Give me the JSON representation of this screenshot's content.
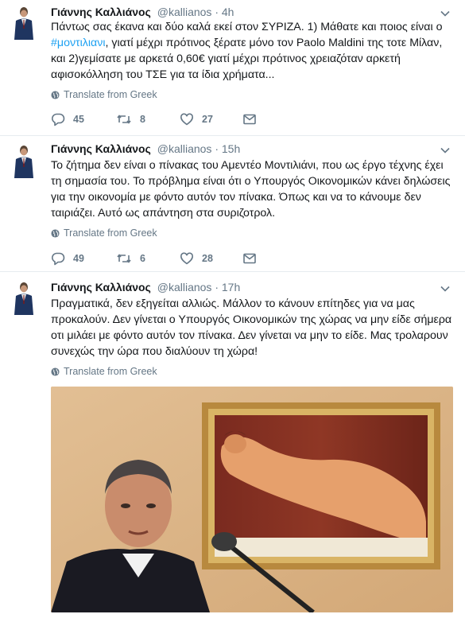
{
  "tweets": [
    {
      "name": "Γιάννης Καλλιάνος",
      "handle": "@kallianos",
      "sep": "·",
      "time": "4h",
      "text_before": "Πάντως σας έκανα και δύο καλά εκεί στον ΣΥΡΙΖΑ. 1) Μάθατε και ποιος είναι ο ",
      "hashtag": "#μοντιλιανι",
      "text_after": ", γιατί μέχρι πρότινος ξέρατε μόνο τον   Paolo Maldini της τοτε Μίλαν, και 2)γεμίσατε με αρκετά 0,60€ γιατί μέχρι πρότινος χρειαζόταν αρκετή αφισοκόλληση του ΤΣΕ για τα ίδια χρήματα...",
      "translate": "Translate from Greek",
      "replies": "45",
      "retweets": "8",
      "likes": "27"
    },
    {
      "name": "Γιάννης Καλλιάνος",
      "handle": "@kallianos",
      "sep": "·",
      "time": "15h",
      "text": "Το ζήτημα δεν είναι ο πίνακας του Αμεντέο Μοντιλιάνι, που ως έργο τέχνης έχει τη σημασία του. Το πρόβλημα είναι ότι ο Υπουργός Οικονομικών κάνει δηλώσεις για την οικονομία με φόντο αυτόν τον πίνακα. Όπως και να το κάνουμε δεν ταιριάζει. Αυτό ως απάντηση στα συριζοτρολ.",
      "translate": "Translate from Greek",
      "replies": "49",
      "retweets": "6",
      "likes": "28"
    },
    {
      "name": "Γιάννης Καλλιάνος",
      "handle": "@kallianos",
      "sep": "·",
      "time": "17h",
      "text": "Πραγματικά, δεν εξηγείται αλλιώς. Μάλλον το κάνουν επίτηδες για να μας προκαλούν. Δεν γίνεται ο Υπουργός Οικονομικών της χώρας να μην είδε σήμερα οτι μιλάει με φόντο αυτόν τον πίνακα. Δεν γίνεται να μην το είδε. Μας τρολαρουν συνεχώς την ώρα που διαλύουν τη χώρα!",
      "translate": "Translate from Greek"
    }
  ],
  "icons": {
    "reply": "reply-icon",
    "retweet": "retweet-icon",
    "like": "heart-icon",
    "dm": "envelope-icon",
    "caret": "chevron-down-icon",
    "globe": "globe-icon"
  },
  "colors": {
    "link": "#1da1f2",
    "secondary": "#657786",
    "text": "#14171a",
    "divider": "#e6ecf0"
  }
}
